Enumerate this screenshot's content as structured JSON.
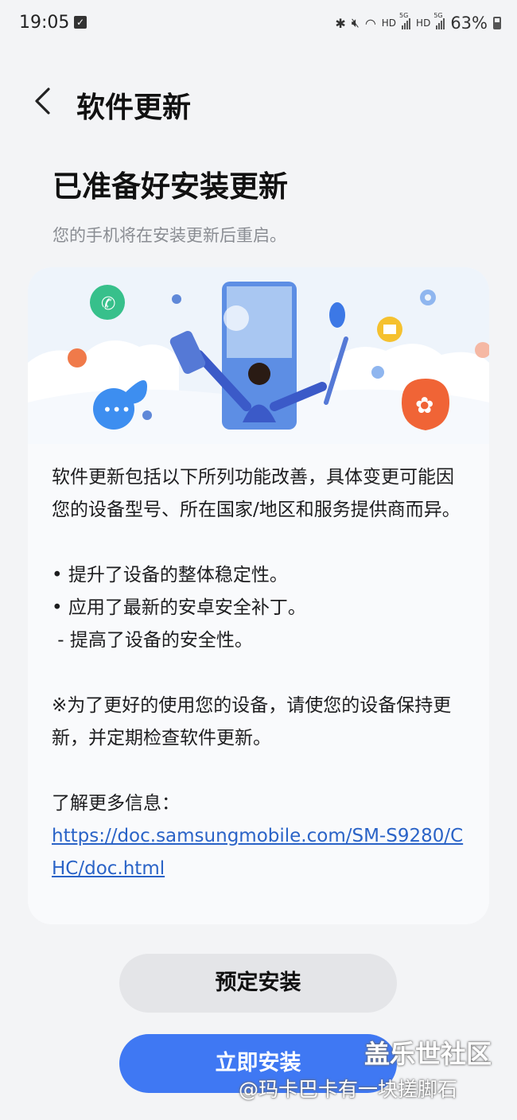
{
  "status_bar": {
    "time": "19:05",
    "network_label_1": "HD",
    "network_label_2": "HD",
    "signal_label_1": "5G",
    "signal_label_2": "5G",
    "battery": "63%"
  },
  "app_bar": {
    "title": "软件更新"
  },
  "main": {
    "headline": "已准备好安装更新",
    "subtitle": "您的手机将在安装更新后重启。"
  },
  "card": {
    "intro": "软件更新包括以下所列功能改善，具体变更可能因您的设备型号、所在国家/地区和服务提供商而异。",
    "bullets": [
      "• 提升了设备的整体稳定性。",
      "• 应用了最新的安卓安全补丁。",
      " - 提高了设备的安全性。"
    ],
    "note": "※为了更好的使用您的设备，请使您的设备保持更新，并定期检查软件更新。",
    "more_info_label": "了解更多信息：",
    "more_info_link": "https://doc.samsungmobile.com/SM-S9280/CHC/doc.html"
  },
  "buttons": {
    "schedule": "预定安装",
    "install_now": "立即安装"
  },
  "watermark": {
    "title": "盖乐世社区",
    "user": "@玛卡巴卡有一块搓脚石"
  },
  "colors": {
    "background": "#f3f4f6",
    "card": "#f9fafc",
    "primary": "#3f78f3",
    "link": "#2a63c7",
    "subtitle": "#8a8d93"
  }
}
